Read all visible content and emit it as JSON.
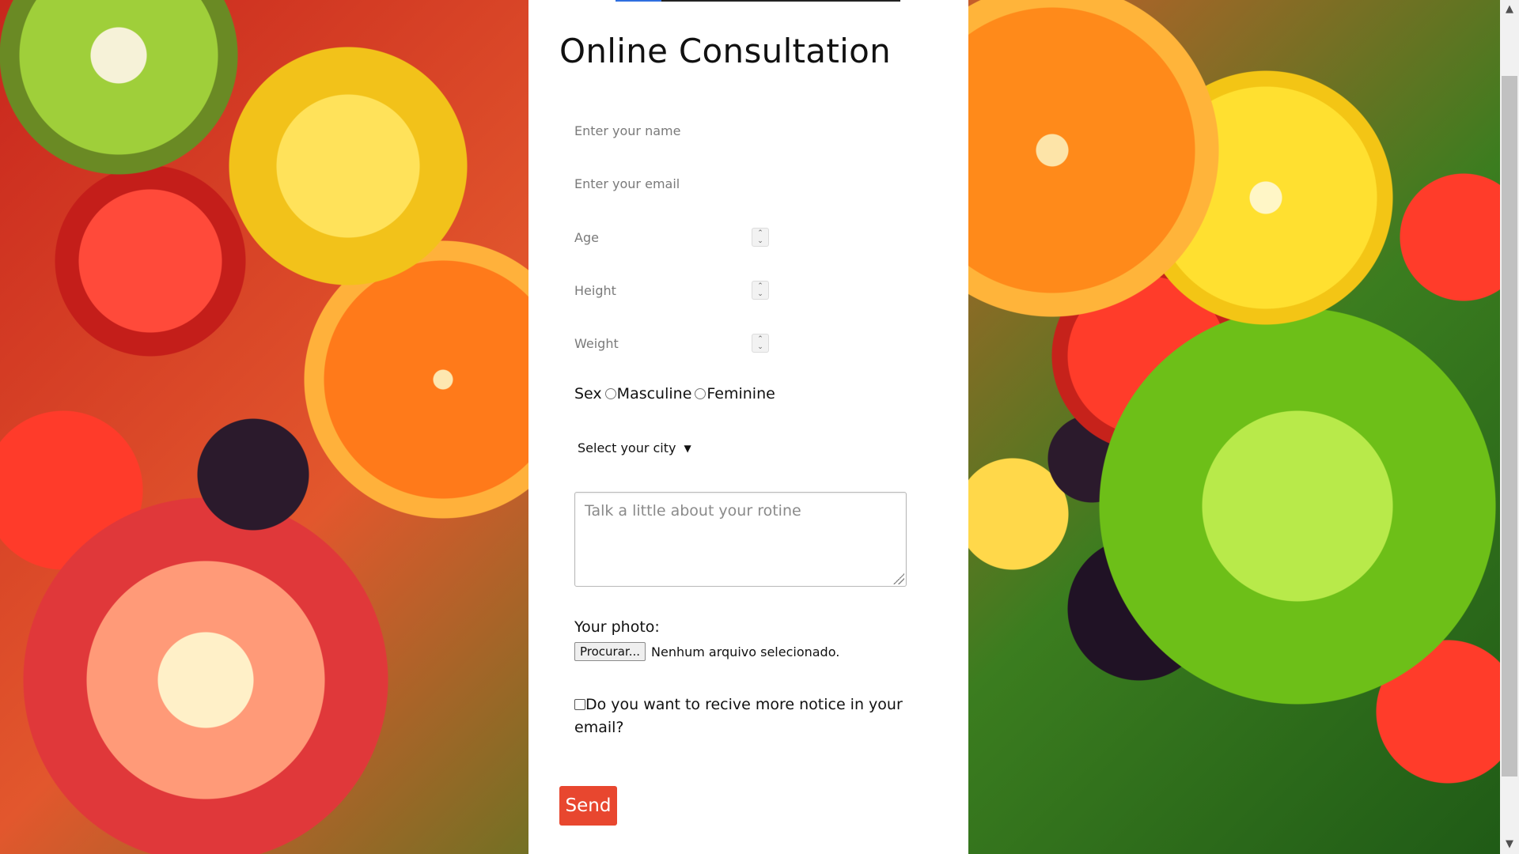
{
  "page": {
    "title": "Online Consultation",
    "progress_fraction": 0.16
  },
  "form": {
    "name_placeholder": "Enter your name",
    "email_placeholder": "Enter your email",
    "age_placeholder": "Age",
    "height_placeholder": "Height",
    "weight_placeholder": "Weight",
    "sex_label": "Sex",
    "sex_options": [
      "Masculine",
      "Feminine"
    ],
    "city_select": "Select your city",
    "routine_placeholder": "Talk a little about your rotine",
    "photo_label": "Your photo:",
    "file_button": "Procurar...",
    "file_status": "Nenhum arquivo selecionado.",
    "newsletter_label": "Do you want to recive more notice in your email?",
    "send_label": "Send"
  },
  "icons": {
    "spinner": "number-stepper-icon",
    "select_chevron": "chevron-down-icon",
    "scroll_up": "chevron-up-icon",
    "scroll_down": "chevron-down-icon"
  },
  "colors": {
    "send_button": "#e8472f",
    "progress_accent": "#2f6fe0"
  }
}
